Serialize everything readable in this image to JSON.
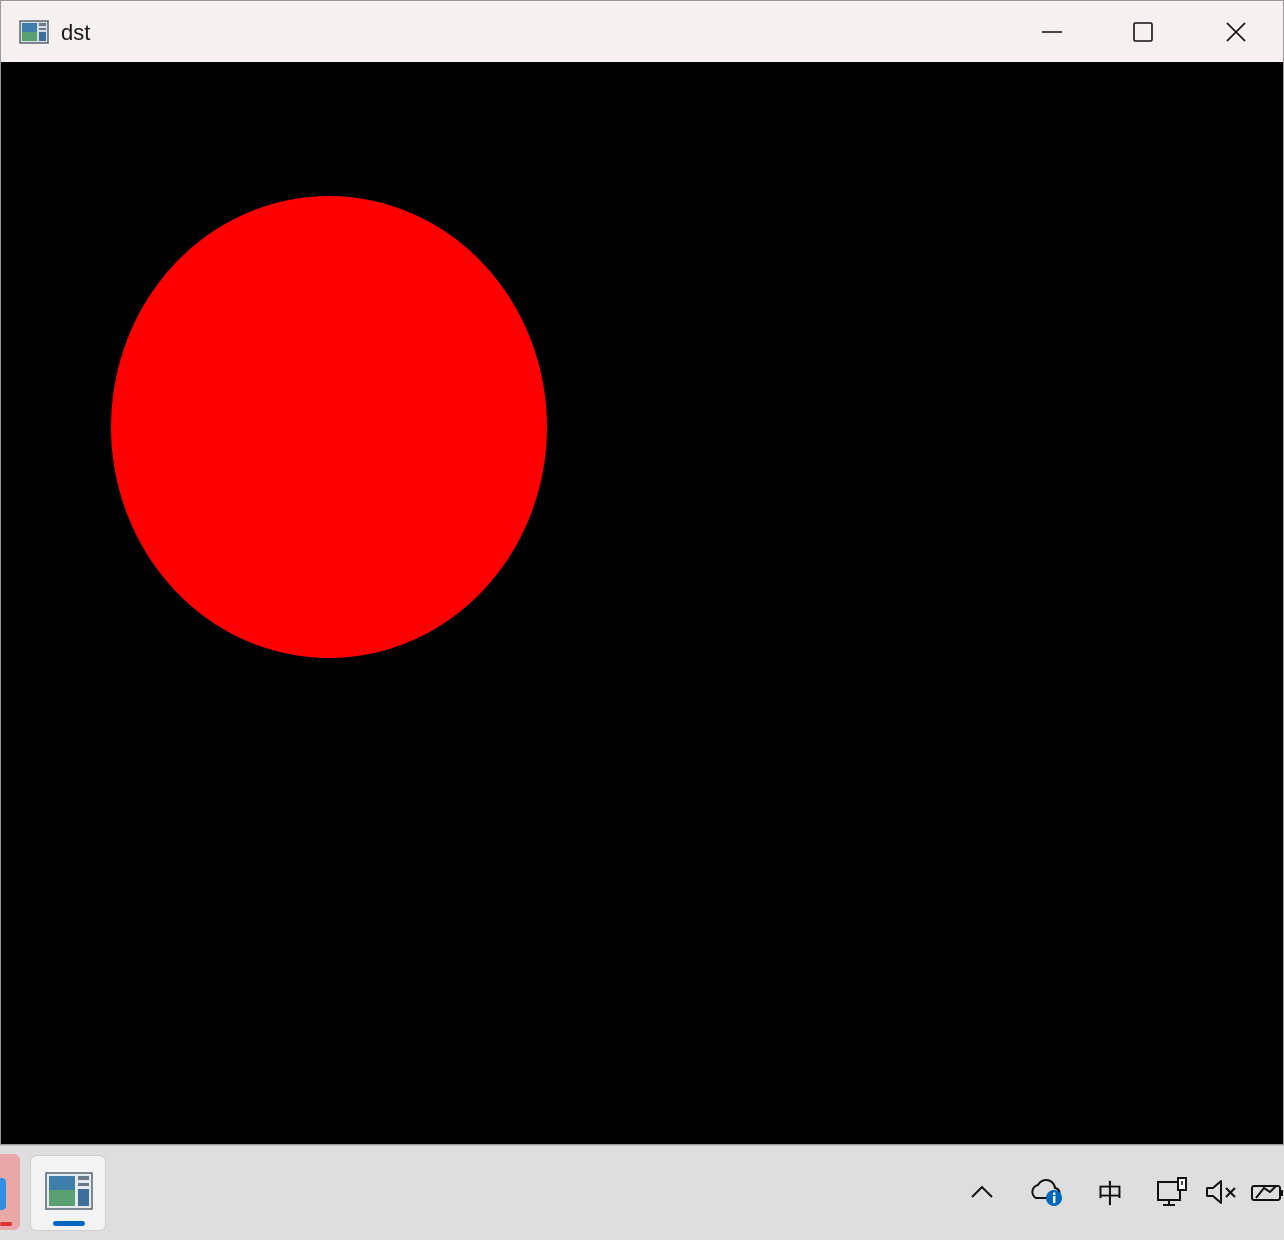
{
  "window": {
    "title": "dst",
    "canvas_background": "#000000",
    "shape_color": "#ff0000"
  },
  "titlebar": {
    "app_icon": "image-viewer-icon",
    "minimize_icon": "minimize-icon",
    "maximize_icon": "maximize-icon",
    "close_icon": "close-icon"
  },
  "taskbar": {
    "pinned_app_icon": "image-viewer-icon",
    "active_indicator_color": "#0067c0",
    "tray": {
      "chevron_icon": "chevron-up-icon",
      "onedrive_icon": "cloud-info-icon",
      "ime_label": "中",
      "network_icon": "network-monitor-icon",
      "volume_icon": "volume-muted-icon",
      "battery_icon": "battery-icon"
    }
  }
}
